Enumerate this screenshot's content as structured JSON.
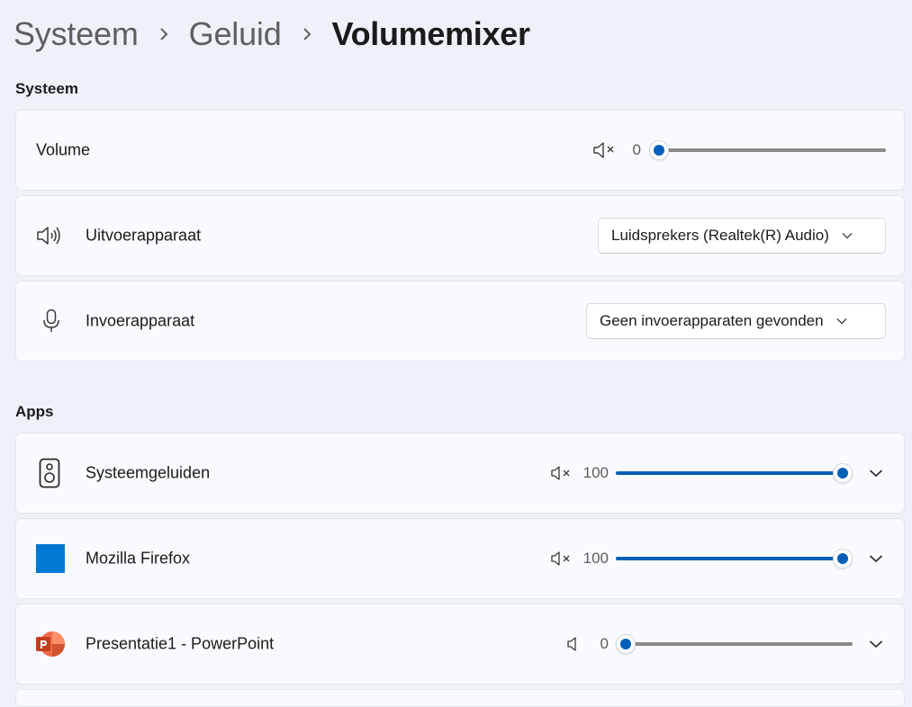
{
  "breadcrumb": {
    "items": [
      "Systeem",
      "Geluid"
    ],
    "current": "Volumemixer"
  },
  "sections": {
    "system": "Systeem",
    "apps": "Apps"
  },
  "system": {
    "volume": {
      "label": "Volume",
      "value": "0",
      "level": 0
    },
    "output": {
      "label": "Uitvoerapparaat",
      "selected": "Luidsprekers (Realtek(R) Audio)"
    },
    "input": {
      "label": "Invoerapparaat",
      "selected": "Geen invoerapparaten gevonden"
    }
  },
  "apps": [
    {
      "name": "Systeemgeluiden",
      "icon": "speaker-device-icon",
      "value": "100",
      "level": 100
    },
    {
      "name": "Mozilla Firefox",
      "icon": "firefox-icon",
      "value": "100",
      "level": 100
    },
    {
      "name": "Presentatie1 - PowerPoint",
      "icon": "powerpoint-icon",
      "value": "0",
      "level": 0
    }
  ],
  "colors": {
    "accent": "#005fb8",
    "background": "#eef2f8",
    "card": "#f9fafd",
    "firefox_tile": "#0078d4",
    "powerpoint": "#c43e1c"
  }
}
